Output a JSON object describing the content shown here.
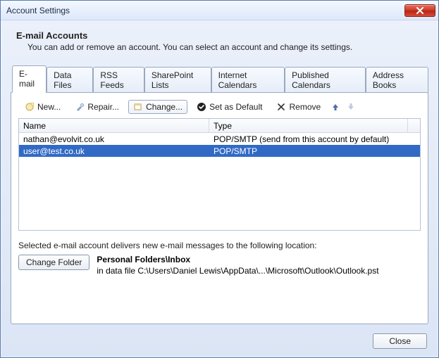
{
  "window": {
    "title": "Account Settings"
  },
  "header": {
    "title": "E-mail Accounts",
    "subtitle": "You can add or remove an account. You can select an account and change its settings."
  },
  "tabs": [
    {
      "label": "E-mail",
      "active": true
    },
    {
      "label": "Data Files"
    },
    {
      "label": "RSS Feeds"
    },
    {
      "label": "SharePoint Lists"
    },
    {
      "label": "Internet Calendars"
    },
    {
      "label": "Published Calendars"
    },
    {
      "label": "Address Books"
    }
  ],
  "toolbar": {
    "new": "New...",
    "repair": "Repair...",
    "change": "Change...",
    "set_default": "Set as Default",
    "remove": "Remove"
  },
  "list": {
    "columns": {
      "name": "Name",
      "type": "Type"
    },
    "rows": [
      {
        "name": "nathan@evolvit.co.uk",
        "type": "POP/SMTP (send from this account by default)",
        "selected": false
      },
      {
        "name": "user@test.co.uk",
        "type": "POP/SMTP",
        "selected": true
      }
    ]
  },
  "delivery": {
    "intro": "Selected e-mail account delivers new e-mail messages to the following location:",
    "change_folder": "Change Folder",
    "location": "Personal Folders\\Inbox",
    "path": "in data file C:\\Users\\Daniel Lewis\\AppData\\...\\Microsoft\\Outlook\\Outlook.pst"
  },
  "footer": {
    "close": "Close"
  }
}
